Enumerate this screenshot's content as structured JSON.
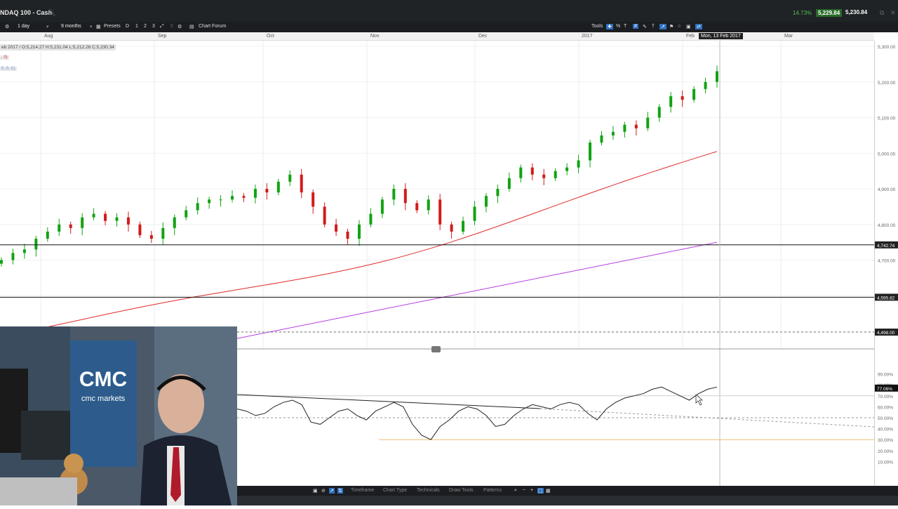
{
  "titlebar": {
    "title": "NDAQ 100 - Cash",
    "change_pct": "14.73%",
    "bid": "5,229.84",
    "ask": "5,230.84"
  },
  "toolbar": {
    "interval": "1 day",
    "range": "9 months",
    "presets_label": "Presets",
    "btn_d": "D",
    "btn_1": "1",
    "btn_2": "2",
    "btn_3": "3",
    "btn_5": "5",
    "chart_forum": "Chart Forum",
    "tools_label": "Tools"
  },
  "months": [
    "Aug",
    "Sep",
    "Oct",
    "Nov",
    "Dec",
    "2017",
    "Feb",
    "Mar"
  ],
  "crosshair_date": "Mon, 13 Feb 2017",
  "ohlc_readout": "eb 2017 / O:5,214.27  H:5,231.04  L:5,212.26  C:5,230.34",
  "indicator1": ", 0)",
  "indicator2": "0, 0, C)",
  "price_axis": {
    "ticks": [
      "5,300.00",
      "5,200.00",
      "5,100.00",
      "5,000.00",
      "4,900.00",
      "4,800.00",
      "4,700.00"
    ],
    "tags": [
      "4,742.74",
      "4,595.82",
      "4,498.00"
    ]
  },
  "rsi_axis": {
    "ticks": [
      "90.00%",
      "80.00%",
      "70.00%",
      "60.00%",
      "50.00%",
      "40.00%",
      "30.00%",
      "20.00%",
      "10.00%"
    ],
    "tag": "77.06%"
  },
  "bottom_menu": [
    "Timeframe",
    "Chart Type",
    "Technicals",
    "Draw Tools",
    "Patterns"
  ],
  "webcam": {
    "logo": "CMC",
    "brand": "cmc markets"
  },
  "colors": {
    "up_candle": "#12a312",
    "down_candle": "#d21b1b",
    "ma_short": "#e02a2a",
    "ma_long": "#b63de0",
    "rsi_line": "#222222"
  },
  "chart_data": {
    "type": "candlestick",
    "title": "NDAQ 100 - Cash",
    "xlabel": "",
    "ylabel": "",
    "ylim": [
      4500,
      5300
    ],
    "x_months": [
      "Aug",
      "Sep",
      "Oct",
      "Nov",
      "Dec",
      "2017",
      "Feb",
      "Mar"
    ],
    "close_series": [
      4700,
      4720,
      4730,
      4760,
      4780,
      4800,
      4790,
      4820,
      4830,
      4810,
      4820,
      4800,
      4770,
      4760,
      4790,
      4820,
      4840,
      4860,
      4870,
      4870,
      4880,
      4875,
      4900,
      4890,
      4920,
      4940,
      4890,
      4850,
      4800,
      4780,
      4760,
      4800,
      4830,
      4870,
      4900,
      4860,
      4840,
      4870,
      4800,
      4780,
      4810,
      4850,
      4880,
      4900,
      4930,
      4960,
      4940,
      4930,
      4950,
      4960,
      4980,
      5030,
      5050,
      5060,
      5080,
      5070,
      5100,
      5130,
      5160,
      5150,
      5180,
      5200,
      5230
    ],
    "series": [
      {
        "name": "MA (short)",
        "start": 4510,
        "end": 5000
      },
      {
        "name": "MA (long)",
        "start": 4480,
        "end": 4750
      }
    ],
    "horizontal_levels": [
      4742.74,
      4595.82,
      4498.0
    ],
    "rsi": {
      "ylim": [
        0,
        100
      ],
      "last": 77.06,
      "values": [
        58,
        56,
        52,
        54,
        60,
        64,
        66,
        62,
        46,
        44,
        50,
        56,
        58,
        52,
        48,
        56,
        60,
        64,
        60,
        44,
        34,
        30,
        42,
        48,
        56,
        60,
        58,
        52,
        42,
        44,
        52,
        58,
        62,
        60,
        58,
        62,
        64,
        62,
        54,
        48,
        58,
        64,
        68,
        70,
        72,
        76,
        78,
        74,
        70,
        66,
        72,
        76,
        78
      ]
    }
  }
}
